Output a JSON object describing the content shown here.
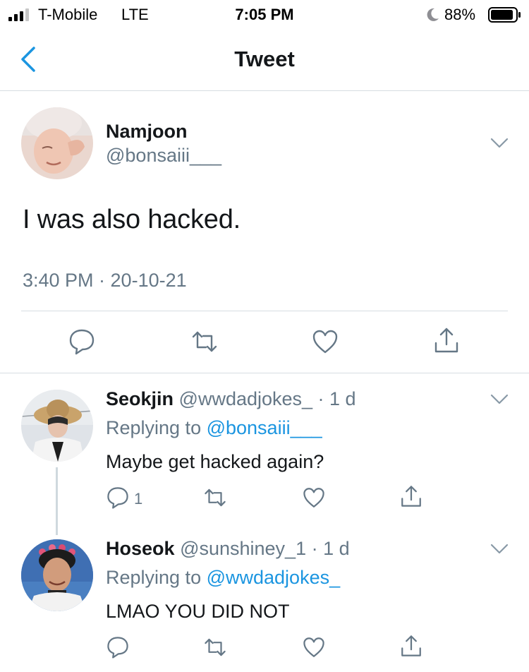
{
  "status_bar": {
    "carrier": "T-Mobile",
    "network": "LTE",
    "time": "7:05 PM",
    "battery_pct": "88%"
  },
  "nav": {
    "title": "Tweet"
  },
  "main_tweet": {
    "name": "Namjoon",
    "handle": "@bonsaiii___",
    "text": "I was also hacked.",
    "timestamp": "3:40 PM · 20-10-21"
  },
  "replies": [
    {
      "name": "Seokjin",
      "handle_meta": "@wwdadjokes_ · 1 d",
      "replying_prefix": "Replying to ",
      "replying_to": "@bonsaiii___",
      "text": "Maybe get hacked again?",
      "reply_count": "1"
    },
    {
      "name": "Hoseok",
      "handle_meta": "@sunshiney_1 · 1 d",
      "replying_prefix": "Replying to ",
      "replying_to": "@wwdadjokes_",
      "text": "LMAO YOU DID NOT",
      "reply_count": ""
    }
  ],
  "colors": {
    "accent": "#1b95e0",
    "muted": "#657786",
    "divider": "#d7dde2"
  },
  "icons": [
    "signal-icon",
    "moon-icon",
    "battery-icon",
    "back-icon",
    "chevron-down-icon",
    "reply-icon",
    "retweet-icon",
    "like-icon",
    "share-icon"
  ]
}
